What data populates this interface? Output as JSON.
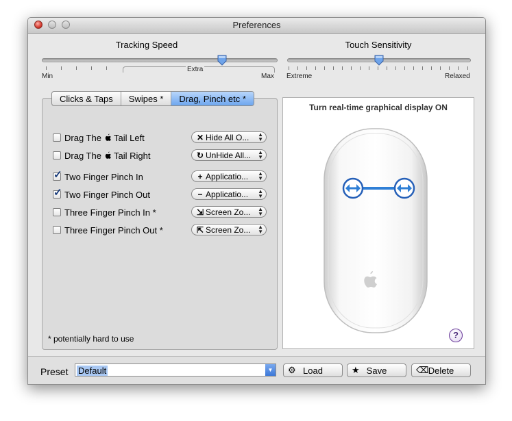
{
  "window": {
    "title": "Preferences"
  },
  "tracking": {
    "title": "Tracking Speed",
    "min_label": "Min",
    "max_label": "Max",
    "extra_label": "Extra"
  },
  "touch": {
    "title": "Touch Sensitivity",
    "min_label": "Extreme",
    "max_label": "Relaxed"
  },
  "tabs": [
    {
      "label": "Clicks & Taps"
    },
    {
      "label": "Swipes *"
    },
    {
      "label": "Drag, Pinch etc *"
    }
  ],
  "gestures": [
    {
      "label_pre": "Drag The",
      "label_post": "Tail Left",
      "checked": false,
      "action_icon": "✕",
      "action": "Hide All O..."
    },
    {
      "label_pre": "Drag The",
      "label_post": "Tail Right",
      "checked": false,
      "action_icon": "↻",
      "action": "UnHide All..."
    },
    {
      "label": "Two Finger Pinch In",
      "checked": true,
      "action_icon": "+",
      "action": "Applicatio..."
    },
    {
      "label": "Two Finger Pinch Out",
      "checked": true,
      "action_icon": "−",
      "action": "Applicatio..."
    },
    {
      "label": "Three Finger Pinch In *",
      "checked": false,
      "action_icon": "⇲",
      "action": "Screen Zo..."
    },
    {
      "label": "Three Finger Pinch Out *",
      "checked": false,
      "action_icon": "⇱",
      "action": "Screen Zo..."
    }
  ],
  "footnote": "* potentially hard to use",
  "display": {
    "title": "Turn real-time graphical display ON",
    "help": "?"
  },
  "preset": {
    "label": "Preset",
    "value": "Default"
  },
  "buttons": {
    "load": "Load",
    "save": "Save",
    "delete": "Delete"
  },
  "icons": {
    "load": "gear-icon",
    "save": "star-icon",
    "delete": "delete-key-icon",
    "help": "question-icon"
  },
  "colors": {
    "tab_active": "#6ea6ee",
    "pinch_indicator": "#2f7fd6",
    "checkmark": "#173a7a"
  }
}
